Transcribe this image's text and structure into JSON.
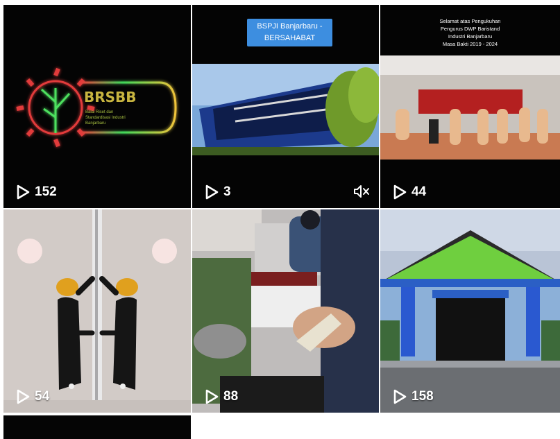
{
  "tiles": [
    {
      "id": "t1",
      "views": "152",
      "logo": {
        "acronym": "BRSBB",
        "line1": "Balai Riset dan",
        "line2": "Standardisasi Industri",
        "line3": "Banjarbaru"
      }
    },
    {
      "id": "t2",
      "views": "3",
      "caption": {
        "line1": "BSPJI Banjarbaru -",
        "line2": "BERSAHABAT"
      },
      "muted": true
    },
    {
      "id": "t3",
      "views": "44",
      "caption": {
        "line1": "Selamat atas Pengukuhan",
        "line2": "Pengurus DWP Baristand",
        "line3": "Industri Banjarbaru",
        "line4": "Masa Bakti 2019 - 2024"
      }
    },
    {
      "id": "t4",
      "views": "54"
    },
    {
      "id": "t5",
      "views": "88"
    },
    {
      "id": "t6",
      "views": "158"
    }
  ],
  "icons": {
    "play": "play-icon",
    "mute": "speaker-muted-icon"
  }
}
